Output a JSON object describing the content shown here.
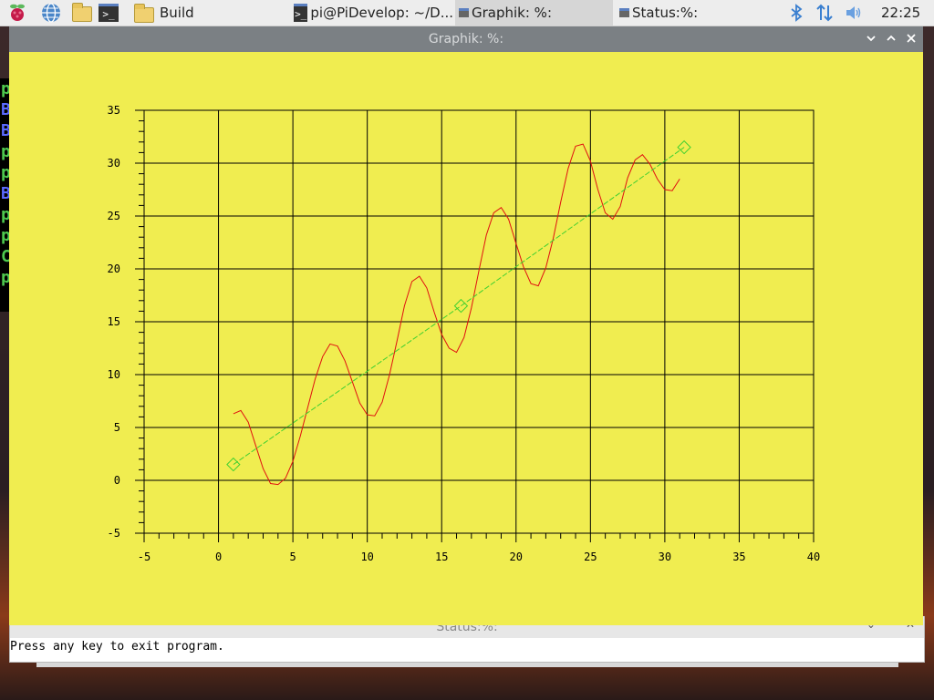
{
  "taskbar": {
    "apps": [
      {
        "name": "raspberry-menu-icon"
      },
      {
        "name": "web-browser-icon"
      },
      {
        "name": "file-manager-icon"
      },
      {
        "name": "terminal-icon"
      }
    ],
    "windows": [
      {
        "label": "Build",
        "icon": "folder-icon",
        "active": false
      },
      {
        "label": "pi@PiDevelop: ~/D...",
        "icon": "terminal-icon",
        "active": false
      },
      {
        "label": "Graphik: %:",
        "icon": "window-icon",
        "active": true
      },
      {
        "label": "Status:%:",
        "icon": "window-icon",
        "active": false
      }
    ],
    "tray": {
      "bluetooth": "bluetooth-icon",
      "network": "network-updown-icon",
      "volume": "volume-icon"
    },
    "clock": "22:25"
  },
  "terminal": {
    "lines": [
      {
        "text": "p",
        "color": "#4ec94e"
      },
      {
        "text": "B",
        "color": "#5a6aff"
      },
      {
        "text": "B",
        "color": "#5a6aff"
      },
      {
        "text": "p",
        "color": "#4ec94e"
      },
      {
        "text": "p",
        "color": "#4ec94e"
      },
      {
        "text": "B",
        "color": "#5a6aff"
      },
      {
        "text": "p",
        "color": "#4ec94e"
      },
      {
        "text": "p",
        "color": "#4ec94e"
      },
      {
        "text": "C",
        "color": "#4ec94e"
      },
      {
        "text": "p",
        "color": "#4ec94e"
      }
    ]
  },
  "graph_window": {
    "title": "Graphik: %:",
    "controls": {
      "minimize": "chevron-down-icon",
      "maximize": "chevron-up-icon",
      "close": "close-icon"
    },
    "background": "#f0ed50"
  },
  "status_window": {
    "title": "Status:%:",
    "text": "Press any key to exit program."
  },
  "chart_data": {
    "type": "line",
    "title": "",
    "xlabel": "",
    "ylabel": "",
    "xlim": [
      -5,
      40
    ],
    "ylim": [
      -5,
      35
    ],
    "x_ticks": [
      -5,
      0,
      5,
      10,
      15,
      20,
      25,
      30,
      35,
      40
    ],
    "y_ticks": [
      -5,
      0,
      5,
      10,
      15,
      20,
      25,
      30,
      35
    ],
    "grid": true,
    "series": [
      {
        "color": "#e01010",
        "marker": "none",
        "x": [
          1.0,
          1.5,
          2.0,
          2.5,
          3.0,
          3.5,
          4.0,
          4.5,
          5.0,
          5.5,
          6.0,
          6.5,
          7.0,
          7.5,
          8.0,
          8.5,
          9.0,
          9.5,
          10.0,
          10.5,
          11.0,
          11.5,
          12.0,
          12.5,
          13.0,
          13.5,
          14.0,
          14.5,
          15.0,
          15.5,
          16.0,
          16.5,
          17.0,
          17.5,
          18.0,
          18.5,
          19.0,
          19.5,
          20.0,
          20.5,
          21.0,
          21.5,
          22.0,
          22.5,
          23.0,
          23.5,
          24.0,
          24.5,
          25.0,
          25.5,
          26.0,
          26.5,
          27.0,
          27.5,
          28.0,
          28.5,
          29.0,
          29.5,
          30.0,
          30.5,
          31.0
        ],
        "y": [
          6.3,
          6.6,
          5.5,
          3.3,
          1.1,
          -0.3,
          -0.4,
          0.2,
          1.8,
          4.2,
          6.9,
          9.6,
          11.7,
          12.9,
          12.7,
          11.3,
          9.3,
          7.3,
          6.2,
          6.1,
          7.4,
          10.0,
          13.2,
          16.5,
          18.8,
          19.3,
          18.2,
          15.9,
          13.8,
          12.5,
          12.1,
          13.5,
          16.3,
          19.8,
          23.2,
          25.3,
          25.8,
          24.7,
          22.4,
          20.2,
          18.6,
          18.4,
          20.1,
          22.9,
          26.3,
          29.5,
          31.6,
          31.8,
          30.2,
          27.5,
          25.3,
          24.7,
          25.9,
          28.6,
          30.3,
          30.8,
          29.9,
          28.5,
          27.5,
          27.4,
          28.5
        ]
      },
      {
        "color": "#40d030",
        "marker": "diamond",
        "x": [
          1.0,
          16.3,
          31.3
        ],
        "y": [
          1.5,
          16.5,
          31.5
        ]
      }
    ]
  }
}
